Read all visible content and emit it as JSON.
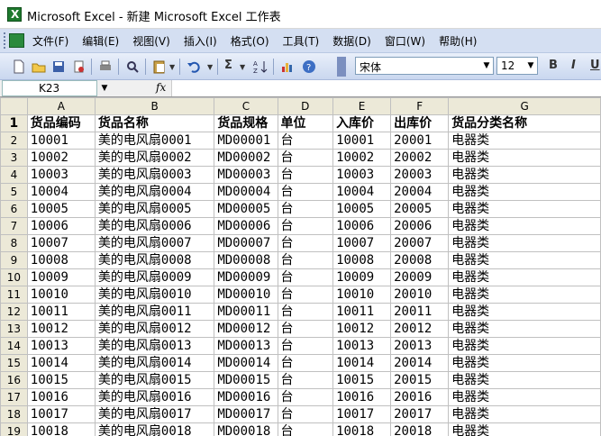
{
  "window": {
    "title": "Microsoft Excel - 新建 Microsoft Excel 工作表"
  },
  "menu": [
    "文件(F)",
    "编辑(E)",
    "视图(V)",
    "插入(I)",
    "格式(O)",
    "工具(T)",
    "数据(D)",
    "窗口(W)",
    "帮助(H)"
  ],
  "toolbar": {
    "font_name": "宋体",
    "font_size": "12",
    "sigma": "Σ",
    "bold": "B",
    "italic": "I",
    "underline": "U"
  },
  "formula_bar": {
    "cell_ref": "K23",
    "fx": "fx",
    "content": ""
  },
  "columns": [
    "A",
    "B",
    "C",
    "D",
    "E",
    "F",
    "G"
  ],
  "rows": [
    {
      "num": "1",
      "cells": [
        "货品编码",
        "货品名称",
        "货品规格",
        "单位",
        "入库价",
        "出库价",
        "货品分类名称"
      ]
    },
    {
      "num": "2",
      "cells": [
        "10001",
        "美的电风扇0001",
        "MD00001",
        "台",
        "10001",
        "20001",
        "电器类"
      ]
    },
    {
      "num": "3",
      "cells": [
        "10002",
        "美的电风扇0002",
        "MD00002",
        "台",
        "10002",
        "20002",
        "电器类"
      ]
    },
    {
      "num": "4",
      "cells": [
        "10003",
        "美的电风扇0003",
        "MD00003",
        "台",
        "10003",
        "20003",
        "电器类"
      ]
    },
    {
      "num": "5",
      "cells": [
        "10004",
        "美的电风扇0004",
        "MD00004",
        "台",
        "10004",
        "20004",
        "电器类"
      ]
    },
    {
      "num": "6",
      "cells": [
        "10005",
        "美的电风扇0005",
        "MD00005",
        "台",
        "10005",
        "20005",
        "电器类"
      ]
    },
    {
      "num": "7",
      "cells": [
        "10006",
        "美的电风扇0006",
        "MD00006",
        "台",
        "10006",
        "20006",
        "电器类"
      ]
    },
    {
      "num": "8",
      "cells": [
        "10007",
        "美的电风扇0007",
        "MD00007",
        "台",
        "10007",
        "20007",
        "电器类"
      ]
    },
    {
      "num": "9",
      "cells": [
        "10008",
        "美的电风扇0008",
        "MD00008",
        "台",
        "10008",
        "20008",
        "电器类"
      ]
    },
    {
      "num": "10",
      "cells": [
        "10009",
        "美的电风扇0009",
        "MD00009",
        "台",
        "10009",
        "20009",
        "电器类"
      ]
    },
    {
      "num": "11",
      "cells": [
        "10010",
        "美的电风扇0010",
        "MD00010",
        "台",
        "10010",
        "20010",
        "电器类"
      ]
    },
    {
      "num": "12",
      "cells": [
        "10011",
        "美的电风扇0011",
        "MD00011",
        "台",
        "10011",
        "20011",
        "电器类"
      ]
    },
    {
      "num": "13",
      "cells": [
        "10012",
        "美的电风扇0012",
        "MD00012",
        "台",
        "10012",
        "20012",
        "电器类"
      ]
    },
    {
      "num": "14",
      "cells": [
        "10013",
        "美的电风扇0013",
        "MD00013",
        "台",
        "10013",
        "20013",
        "电器类"
      ]
    },
    {
      "num": "15",
      "cells": [
        "10014",
        "美的电风扇0014",
        "MD00014",
        "台",
        "10014",
        "20014",
        "电器类"
      ]
    },
    {
      "num": "16",
      "cells": [
        "10015",
        "美的电风扇0015",
        "MD00015",
        "台",
        "10015",
        "20015",
        "电器类"
      ]
    },
    {
      "num": "17",
      "cells": [
        "10016",
        "美的电风扇0016",
        "MD00016",
        "台",
        "10016",
        "20016",
        "电器类"
      ]
    },
    {
      "num": "18",
      "cells": [
        "10017",
        "美的电风扇0017",
        "MD00017",
        "台",
        "10017",
        "20017",
        "电器类"
      ]
    },
    {
      "num": "19",
      "cells": [
        "10018",
        "美的电风扇0018",
        "MD00018",
        "台",
        "10018",
        "20018",
        "电器类"
      ]
    }
  ]
}
